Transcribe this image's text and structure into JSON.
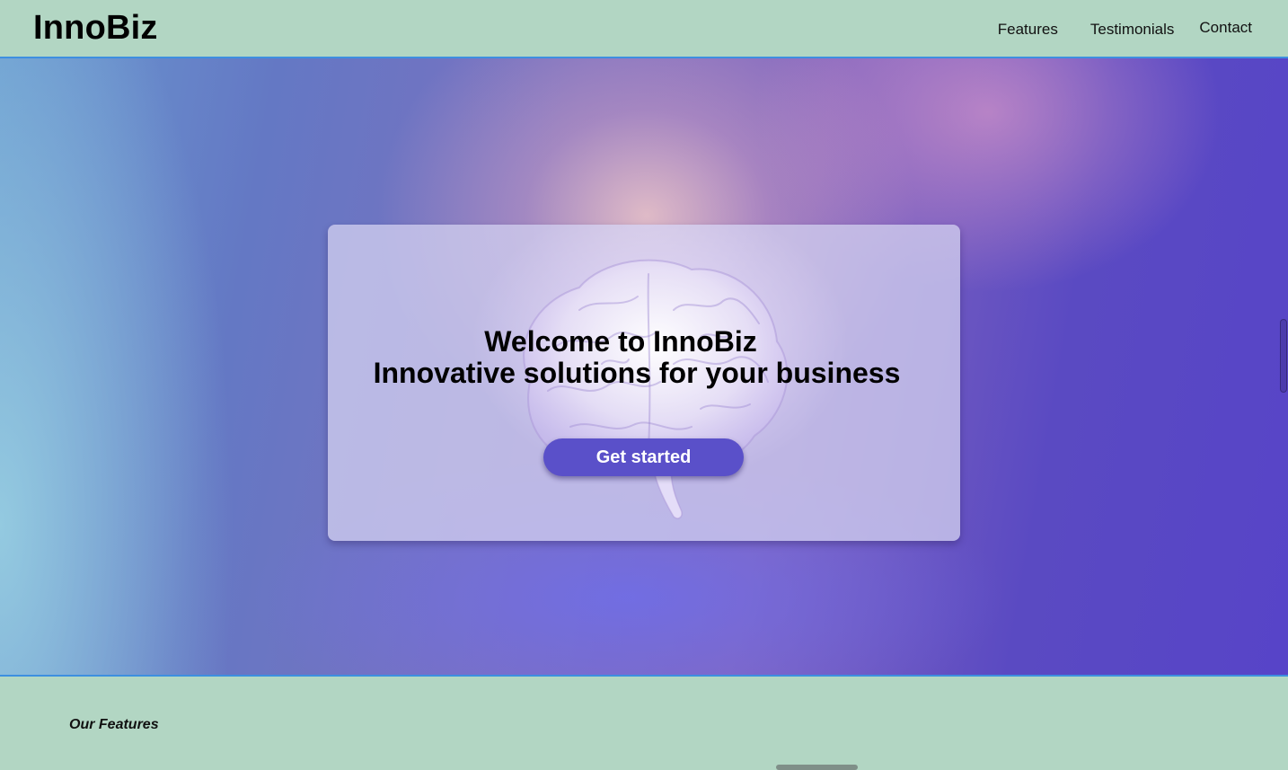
{
  "header": {
    "logo": "InnoBiz",
    "nav": {
      "features": "Features",
      "testimonials": "Testimonials",
      "contact": "Contact"
    }
  },
  "hero": {
    "title_line1": "Welcome to InnoBiz",
    "title_line2": "Innovative solutions for your business",
    "cta_label": "Get started",
    "background_image": "brain-illustration"
  },
  "features": {
    "heading": "Our Features"
  },
  "colors": {
    "header_bg": "#b2d6c3",
    "divider": "#3d8fe0",
    "cta_bg": "#5a50c9",
    "hero_gradient_start": "#6a9ad0",
    "hero_gradient_end": "#5744c8"
  }
}
